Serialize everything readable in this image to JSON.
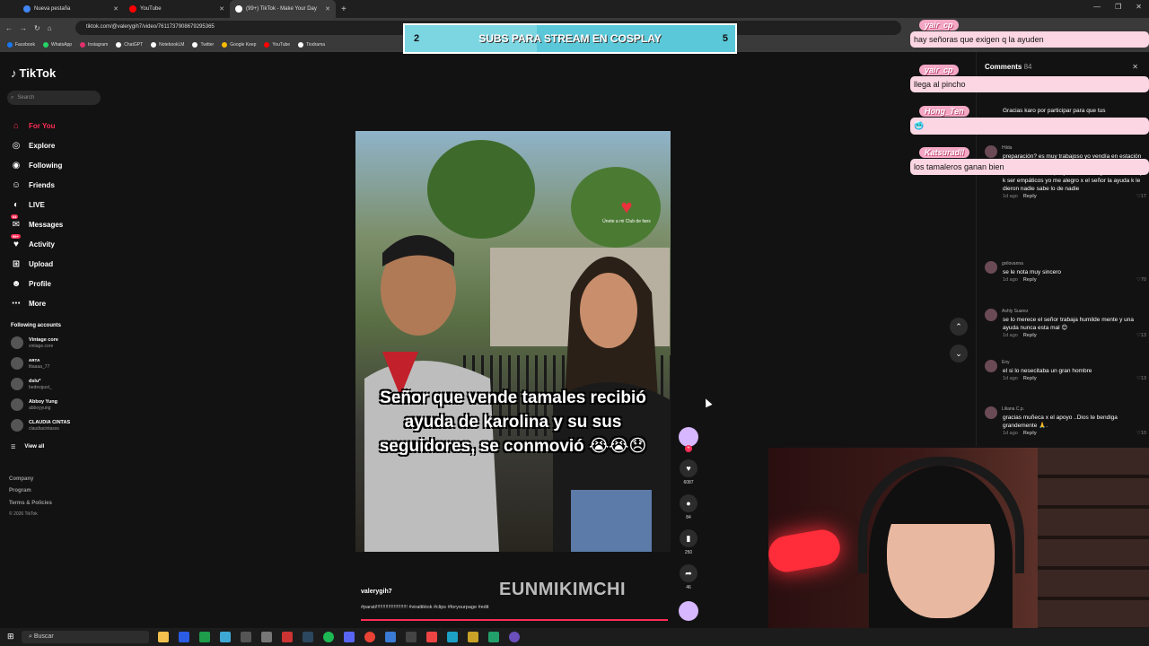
{
  "browser": {
    "tabs": [
      {
        "title": "Nueva pestaña",
        "color": "#4285f4"
      },
      {
        "title": "YouTube",
        "color": "#ff0000"
      },
      {
        "title": "(99+) TikTok - Make Your Day",
        "color": "#ffffff"
      }
    ],
    "url": "tiktok.com/@valerygih7/video/7611737908679295365",
    "bookmarks": [
      {
        "label": "Facebook",
        "color": "#1877f2"
      },
      {
        "label": "WhatsApp",
        "color": "#25d366"
      },
      {
        "label": "Instagram",
        "color": "#e1306c"
      },
      {
        "label": "ChatGPT",
        "color": "#ffffff"
      },
      {
        "label": "NotebookLM",
        "color": "#ffffff"
      },
      {
        "label": "Twitter",
        "color": "#ffffff"
      },
      {
        "label": "Google Keep",
        "color": "#fbbc04"
      },
      {
        "label": "YouTube",
        "color": "#ff0000"
      },
      {
        "label": "Tiodrama",
        "color": "#ffffff"
      }
    ]
  },
  "sidebar": {
    "logo": "TikTok",
    "search_placeholder": "Search",
    "nav": [
      {
        "label": "For You",
        "icon": "home-icon",
        "glyph": "⌂"
      },
      {
        "label": "Explore",
        "icon": "compass-icon",
        "glyph": "◎"
      },
      {
        "label": "Following",
        "icon": "following-icon",
        "glyph": "◉"
      },
      {
        "label": "Friends",
        "icon": "friends-icon",
        "glyph": "☺"
      },
      {
        "label": "LIVE",
        "icon": "live-icon",
        "glyph": "◐"
      },
      {
        "label": "Messages",
        "icon": "messages-icon",
        "glyph": "✉"
      },
      {
        "label": "Activity",
        "icon": "activity-icon",
        "glyph": "♥"
      },
      {
        "label": "Upload",
        "icon": "upload-icon",
        "glyph": "⊞"
      },
      {
        "label": "Profile",
        "icon": "profile-icon",
        "glyph": "☻"
      },
      {
        "label": "More",
        "icon": "more-icon",
        "glyph": "⋯"
      }
    ],
    "messages_badge": "64",
    "activity_badge": "99+",
    "following_title": "Following accounts",
    "accounts": [
      {
        "name": "Vintage core",
        "handle": "vintage.core"
      },
      {
        "name": "ᴀʀᴛᴀ",
        "handle": "lttaaaa_77"
      },
      {
        "name": "dslu*",
        "handle": "bedevgust_"
      },
      {
        "name": "Abboy Yung",
        "handle": "abboyyung"
      },
      {
        "name": "CLAUDIA CINTAS",
        "handle": "claudiacintasss"
      }
    ],
    "view_all": "View all",
    "footer": {
      "company": "Company",
      "program": "Program",
      "terms": "Terms & Policies",
      "copyright": "© 2026 TikTok"
    }
  },
  "video": {
    "caption": "Señor que vende tamales recibió ayuda de karolina y su sus seguidores, se conmovió 😭😭😞",
    "filter_text": "Únete a mi Club de fans",
    "author": "valerygih7",
    "hashtags": "#parati!!!!!!!!!!!!!!!!!!!!!!! #viraltiktok #clips #foryourpage #edit",
    "likes": "6087",
    "comments": "84",
    "saves": "250",
    "shares": "46",
    "watermark": "EUNMIKIMCHI"
  },
  "comments_panel": {
    "title": "Comments",
    "count": "84",
    "items": [
      {
        "user": "",
        "text": "Gracias karo por participar para que tus",
        "time": "",
        "reply": "",
        "likes": ""
      },
      {
        "user": "Hilda",
        "text": "preparación? es muy trabajoso yo vendía en estación caja de agua y me votaban los mismos ambulantes hasta los del municipio y no es k uno gane mucho hay k ser empáticos yo me alegro x el señor la ayuda k le dieron nadie sabe lo de nadie",
        "time": "1d ago",
        "reply": "Reply",
        "likes": "17"
      },
      {
        "user": "gvilovanna",
        "text": "se le nota muy sincero",
        "time": "1d ago",
        "reply": "Reply",
        "likes": "70"
      },
      {
        "user": "Ashly Suarez",
        "text": "se lo merece el señor trabaja humilde mente y una ayuda nunca esta mal 😊",
        "time": "1d ago",
        "reply": "Reply",
        "likes": "13"
      },
      {
        "user": "Eny",
        "text": "el si lo nesecitaba un gran hombre",
        "time": "1d ago",
        "reply": "Reply",
        "likes": "13"
      },
      {
        "user": "Liliana C.p.",
        "text": "gracias muñeca x el apoyo ..Dios te bendiga grandemente 🙏.",
        "time": "1d ago",
        "reply": "Reply",
        "likes": "10"
      }
    ]
  },
  "stream": {
    "subgoal_current": "2",
    "subgoal_title": "SUBS PARA STREAM EN COSPLAY",
    "subgoal_target": "5",
    "subgoal_progress": 0.4,
    "chat": [
      {
        "user": "yair_cp",
        "message": "hay señoras que exigen q la ayuden"
      },
      {
        "user": "yair_cp",
        "message": "llega al pincho"
      },
      {
        "user": "Hong_Ten",
        "message": "🥶"
      },
      {
        "user": "Katsuradll",
        "message": "los tamaleros ganan bien"
      }
    ]
  },
  "taskbar": {
    "search_placeholder": "Buscar"
  },
  "colors": {
    "accent": "#fe2c55",
    "chat_bubble": "#fcd6e3",
    "subgoal": "#5ac8d8"
  }
}
